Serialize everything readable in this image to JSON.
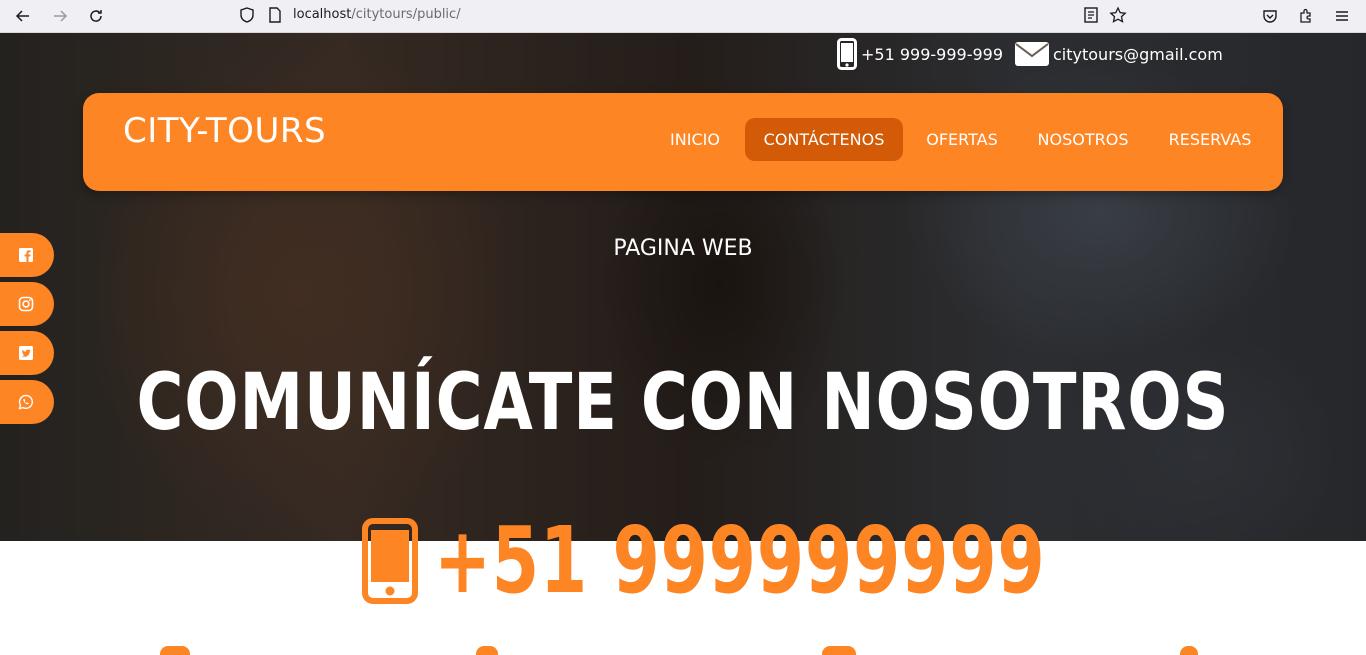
{
  "browser": {
    "url_host": "localhost",
    "url_path": "/citytours/public/",
    "icons": [
      "back-icon",
      "forward-icon",
      "reload-icon",
      "shield-icon",
      "page-icon",
      "reader-view-icon",
      "star-icon",
      "pocket-icon",
      "extensions-icon",
      "menu-icon"
    ]
  },
  "contact": {
    "phone": "+51 999-999-999",
    "email": "citytours@gmail.com"
  },
  "navbar": {
    "brand": "CITY-TOURS",
    "items": [
      {
        "label": "INICIO",
        "active": false
      },
      {
        "label": "CONTÁCTENOS",
        "active": true
      },
      {
        "label": "OFERTAS",
        "active": false
      },
      {
        "label": "NOSOTROS",
        "active": false
      },
      {
        "label": "RESERVAS",
        "active": false
      }
    ]
  },
  "hero": {
    "subtitle": "PAGINA WEB",
    "title": "COMUNÍCATE CON NOSOTROS"
  },
  "social": [
    "facebook-icon",
    "instagram-icon",
    "twitter-icon",
    "whatsapp-icon"
  ],
  "big_phone": {
    "number": "+51 999999999"
  },
  "colors": {
    "accent": "#fd8524",
    "accent_dark": "#d35a06",
    "text_light": "#ffffff"
  }
}
